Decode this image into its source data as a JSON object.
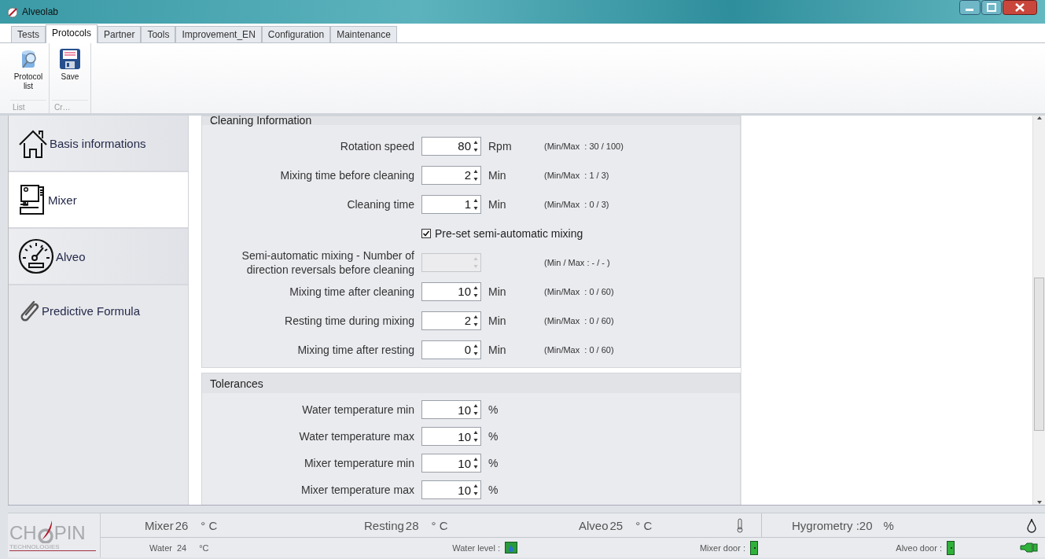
{
  "window": {
    "title": "Alveolab"
  },
  "tabs": [
    {
      "label": "Tests",
      "selected": false
    },
    {
      "label": "Protocols",
      "selected": true
    },
    {
      "label": "Partner",
      "selected": false
    },
    {
      "label": "Tools",
      "selected": false
    },
    {
      "label": "Improvement_EN",
      "selected": false
    },
    {
      "label": "Configuration",
      "selected": false
    },
    {
      "label": "Maintenance",
      "selected": false
    }
  ],
  "ribbon": {
    "groups": [
      {
        "label": "List",
        "buttons": [
          {
            "label": "Protocol list"
          }
        ]
      },
      {
        "label": "Cr…",
        "buttons": [
          {
            "label": "Save"
          }
        ]
      }
    ]
  },
  "sidebar": {
    "items": [
      {
        "label": "Basis informations",
        "selected": false
      },
      {
        "label": "Mixer",
        "selected": true
      },
      {
        "label": "Alveo",
        "selected": false
      },
      {
        "label": "Predictive Formula",
        "selected": false
      }
    ]
  },
  "sections": [
    {
      "title": "Cleaning Information",
      "rows": [
        {
          "kind": "spin",
          "label": "Rotation speed",
          "value": "80",
          "unit": "Rpm",
          "range": "(Min/Max  : 30 / 100)",
          "disabled": false
        },
        {
          "kind": "spin",
          "label": "Mixing time before cleaning",
          "value": "2",
          "unit": "Min",
          "range": "(Min/Max  : 1 / 3)",
          "disabled": false
        },
        {
          "kind": "spin",
          "label": "Cleaning time",
          "value": "1",
          "unit": "Min",
          "range": "(Min/Max  : 0 / 3)",
          "disabled": false
        },
        {
          "kind": "checkbox",
          "label": "Pre-set semi-automatic mixing",
          "checked": true
        },
        {
          "kind": "spin",
          "label": "Semi-automatic mixing - Number of direction reversals before cleaning",
          "range": "(Min / Max : - / - )",
          "disabled": true
        },
        {
          "kind": "spin",
          "label": "Mixing time after cleaning",
          "value": "10",
          "unit": "Min",
          "range": "(Min/Max  : 0 / 60)",
          "disabled": false
        },
        {
          "kind": "spin",
          "label": "Resting time during mixing",
          "value": "2",
          "unit": "Min",
          "range": "(Min/Max  : 0 / 60)",
          "disabled": false
        },
        {
          "kind": "spin",
          "label": "Mixing time after resting",
          "value": "0",
          "unit": "Min",
          "range": "(Min/Max  : 0 / 60)",
          "disabled": false
        }
      ]
    },
    {
      "title": "Tolerances",
      "rows": [
        {
          "kind": "spin",
          "label": "Water temperature min",
          "value": "10",
          "unit": "%",
          "disabled": false
        },
        {
          "kind": "spin",
          "label": "Water temperature max",
          "value": "10",
          "unit": "%",
          "disabled": false
        },
        {
          "kind": "spin",
          "label": "Mixer temperature min",
          "value": "10",
          "unit": "%",
          "disabled": false
        },
        {
          "kind": "spin",
          "label": "Mixer temperature max",
          "value": "10",
          "unit": "%",
          "disabled": false
        }
      ]
    }
  ],
  "status_bar": {
    "logo": {
      "name_parts": [
        "CH",
        "PIN"
      ],
      "tagline": "TECHNOLOGIES"
    },
    "readings": [
      {
        "label": "Mixer",
        "value": "26",
        "unit": "° C"
      },
      {
        "label": "Resting",
        "value": "28",
        "unit": "° C"
      },
      {
        "label": "Alveo",
        "value": "25",
        "unit": "° C"
      },
      {
        "label": "Hygrometry :",
        "value": "20",
        "unit": "%"
      }
    ],
    "water": {
      "label": "Water",
      "value": "24",
      "unit": "°C"
    },
    "indicators": [
      {
        "label": "Water level :"
      },
      {
        "label": "Mixer door :"
      },
      {
        "label": "Alveo door :"
      }
    ]
  }
}
